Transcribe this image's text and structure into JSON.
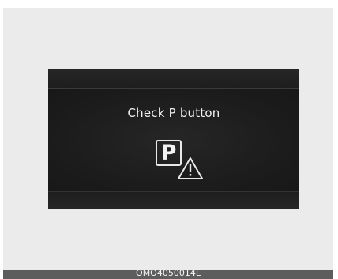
{
  "display": {
    "message": "Check P button",
    "park_icon_letter": "P",
    "icons": [
      "park-button-icon",
      "warning-triangle-icon"
    ],
    "text_color": "#f2f2f2",
    "panel_color": "#1c1c1c",
    "background_color": "#ebebeb"
  },
  "caption": {
    "code": "OMO4050014L"
  }
}
